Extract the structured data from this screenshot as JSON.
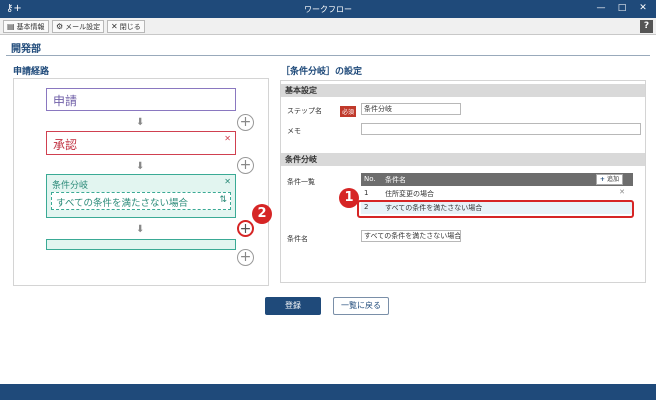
{
  "window": {
    "title": "ワークフロー",
    "app_icon": "key-icon"
  },
  "toolbar": {
    "basic_info": "基本情報",
    "mail_settings": "メール設定",
    "close": "閉じる",
    "help": "?"
  },
  "header": {
    "department": "開発部"
  },
  "route": {
    "title": "申請経路",
    "steps": [
      {
        "label": "申請"
      },
      {
        "label": "承認"
      },
      {
        "label": "条件分岐",
        "condition": "すべての条件を満たさない場合"
      }
    ]
  },
  "settings": {
    "title": "［条件分岐］の設定",
    "basic_header": "基本設定",
    "step_name_label": "ステップ名",
    "required_badge": "必須",
    "step_name_value": "条件分岐",
    "memo_label": "メモ",
    "memo_value": "",
    "cond_header": "条件分岐",
    "cond_list_label": "条件一覧",
    "table": {
      "col_no": "No.",
      "col_name": "条件名",
      "add": "追加",
      "rows": [
        {
          "no": "1",
          "name": "住所変更の場合"
        },
        {
          "no": "2",
          "name": "すべての条件を満たさない場合"
        }
      ]
    },
    "cond_name_label": "条件名",
    "cond_name_value": "すべての条件を満たさない場合"
  },
  "buttons": {
    "register": "登録",
    "back": "一覧に戻る"
  },
  "callouts": {
    "one": "1",
    "two": "2"
  },
  "colors": {
    "brand": "#1f4a7a",
    "highlight": "#d62525",
    "step_apply": "#8a78c0",
    "step_approve": "#d04050",
    "step_branch": "#3aaa95"
  }
}
